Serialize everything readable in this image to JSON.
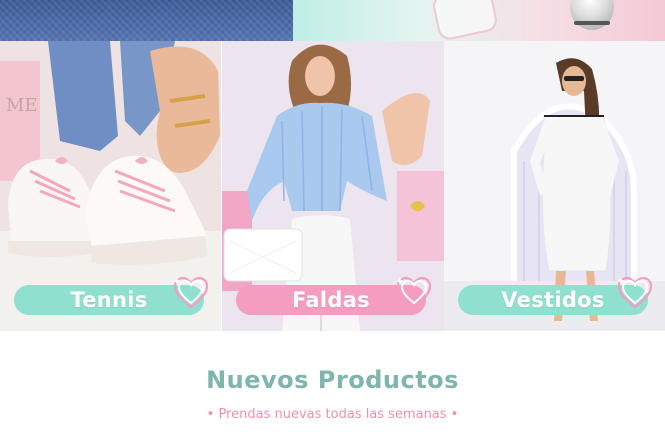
{
  "categories": [
    {
      "label": "Tennis",
      "color": "#8fe0cf",
      "image": "sneakers-photo"
    },
    {
      "label": "Faldas",
      "color": "#f59cc1",
      "image": "skirt-outfit-photo"
    },
    {
      "label": "Vestidos",
      "color": "#8fe0cf",
      "image": "white-dress-photo"
    }
  ],
  "section": {
    "title": "Nuevos Productos",
    "subtitle": "• Prendas nuevas todas las semanas •"
  },
  "colors": {
    "title": "#7fb5ad",
    "subtitle": "#ef8fb0",
    "heart": "#f59cc1"
  }
}
